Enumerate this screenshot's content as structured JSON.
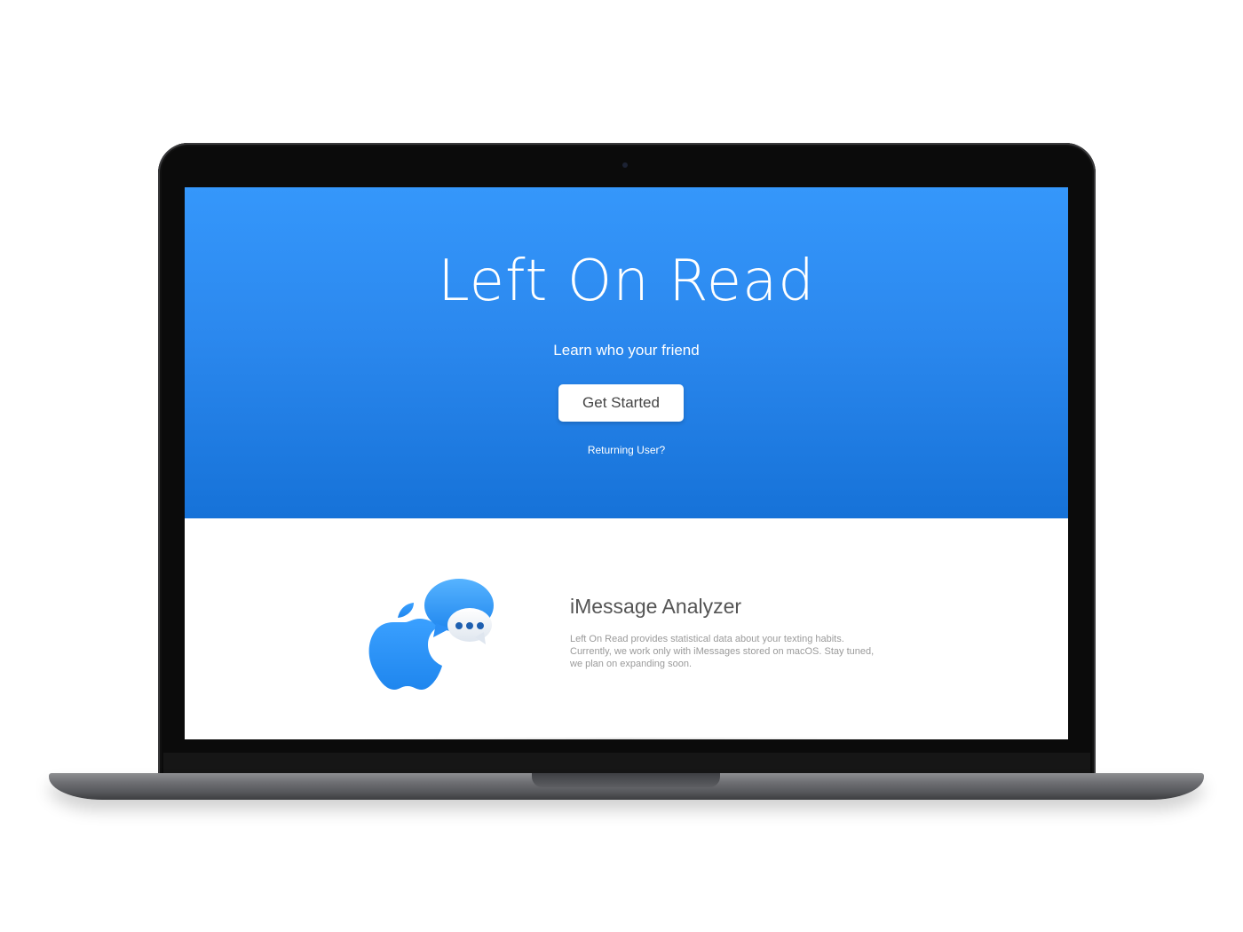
{
  "hero": {
    "title": "Left On Read",
    "subtitle": "Learn who your friend",
    "cta_label": "Get Started",
    "returning_link": "Returning User?"
  },
  "feature": {
    "title": "iMessage Analyzer",
    "description": "Left On Read provides statistical data about your texting habits. Currently, we work only with iMessages stored on macOS. Stay tuned, we plan on expanding soon.",
    "icons": [
      "apple-logo-icon",
      "chat-bubbles-icon"
    ]
  },
  "colors": {
    "hero_top": "#3597fb",
    "hero_bottom": "#1672d8",
    "icon_blue": "#2b8ff5",
    "body_text": "#9a9a9a"
  }
}
